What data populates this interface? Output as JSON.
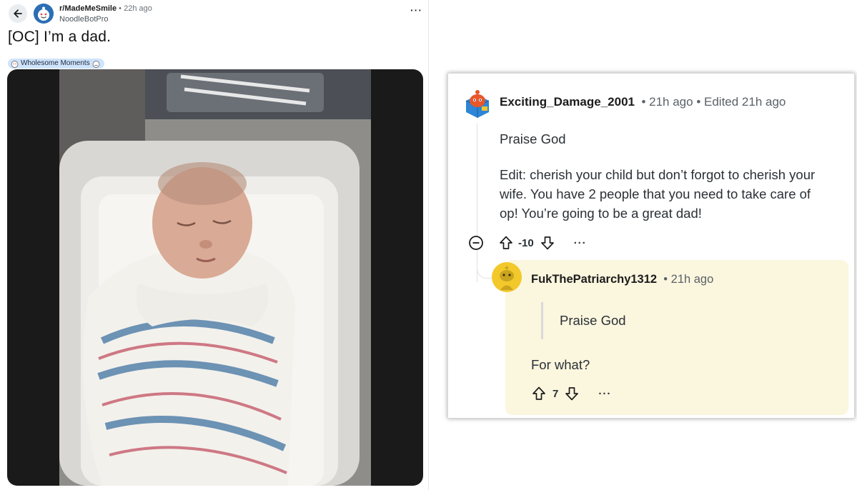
{
  "post": {
    "subreddit": "r/MadeMeSmile",
    "time": "22h ago",
    "author": "NoodleBotPro",
    "title": "[OC] I’m a dad.",
    "flair": "Wholesome Moments",
    "menu_label": "···"
  },
  "comments": {
    "top": {
      "username": "Exciting_Damage_2001",
      "time": "21h ago",
      "edited": "Edited 21h ago",
      "body_line1": "Praise God",
      "body_lines": [
        "Edit: cherish your child but don’t forgot to cherish your",
        "wife. You have 2 people that you need to take care of",
        "op! You’re going to be a great dad!"
      ],
      "score": "-10",
      "more_label": "···"
    },
    "reply": {
      "username": "FukThePatriarchy1312",
      "time": "21h ago",
      "quote": "Praise God",
      "body": "For what?",
      "score": "7",
      "more_label": "···"
    }
  },
  "colors": {
    "flair_bg": "#cfe3fb",
    "reply_highlight_bg": "#fbf6de",
    "subreddit_avatar": "#2b6fb5",
    "snoo_orange": "#e8562a",
    "snoo_yellow": "#f2c82b"
  },
  "icons": [
    "back-arrow-icon",
    "subreddit-avatar-icon",
    "flair-emoji-icon",
    "collapse-icon",
    "upvote-icon",
    "downvote-icon",
    "more-options-icon"
  ]
}
